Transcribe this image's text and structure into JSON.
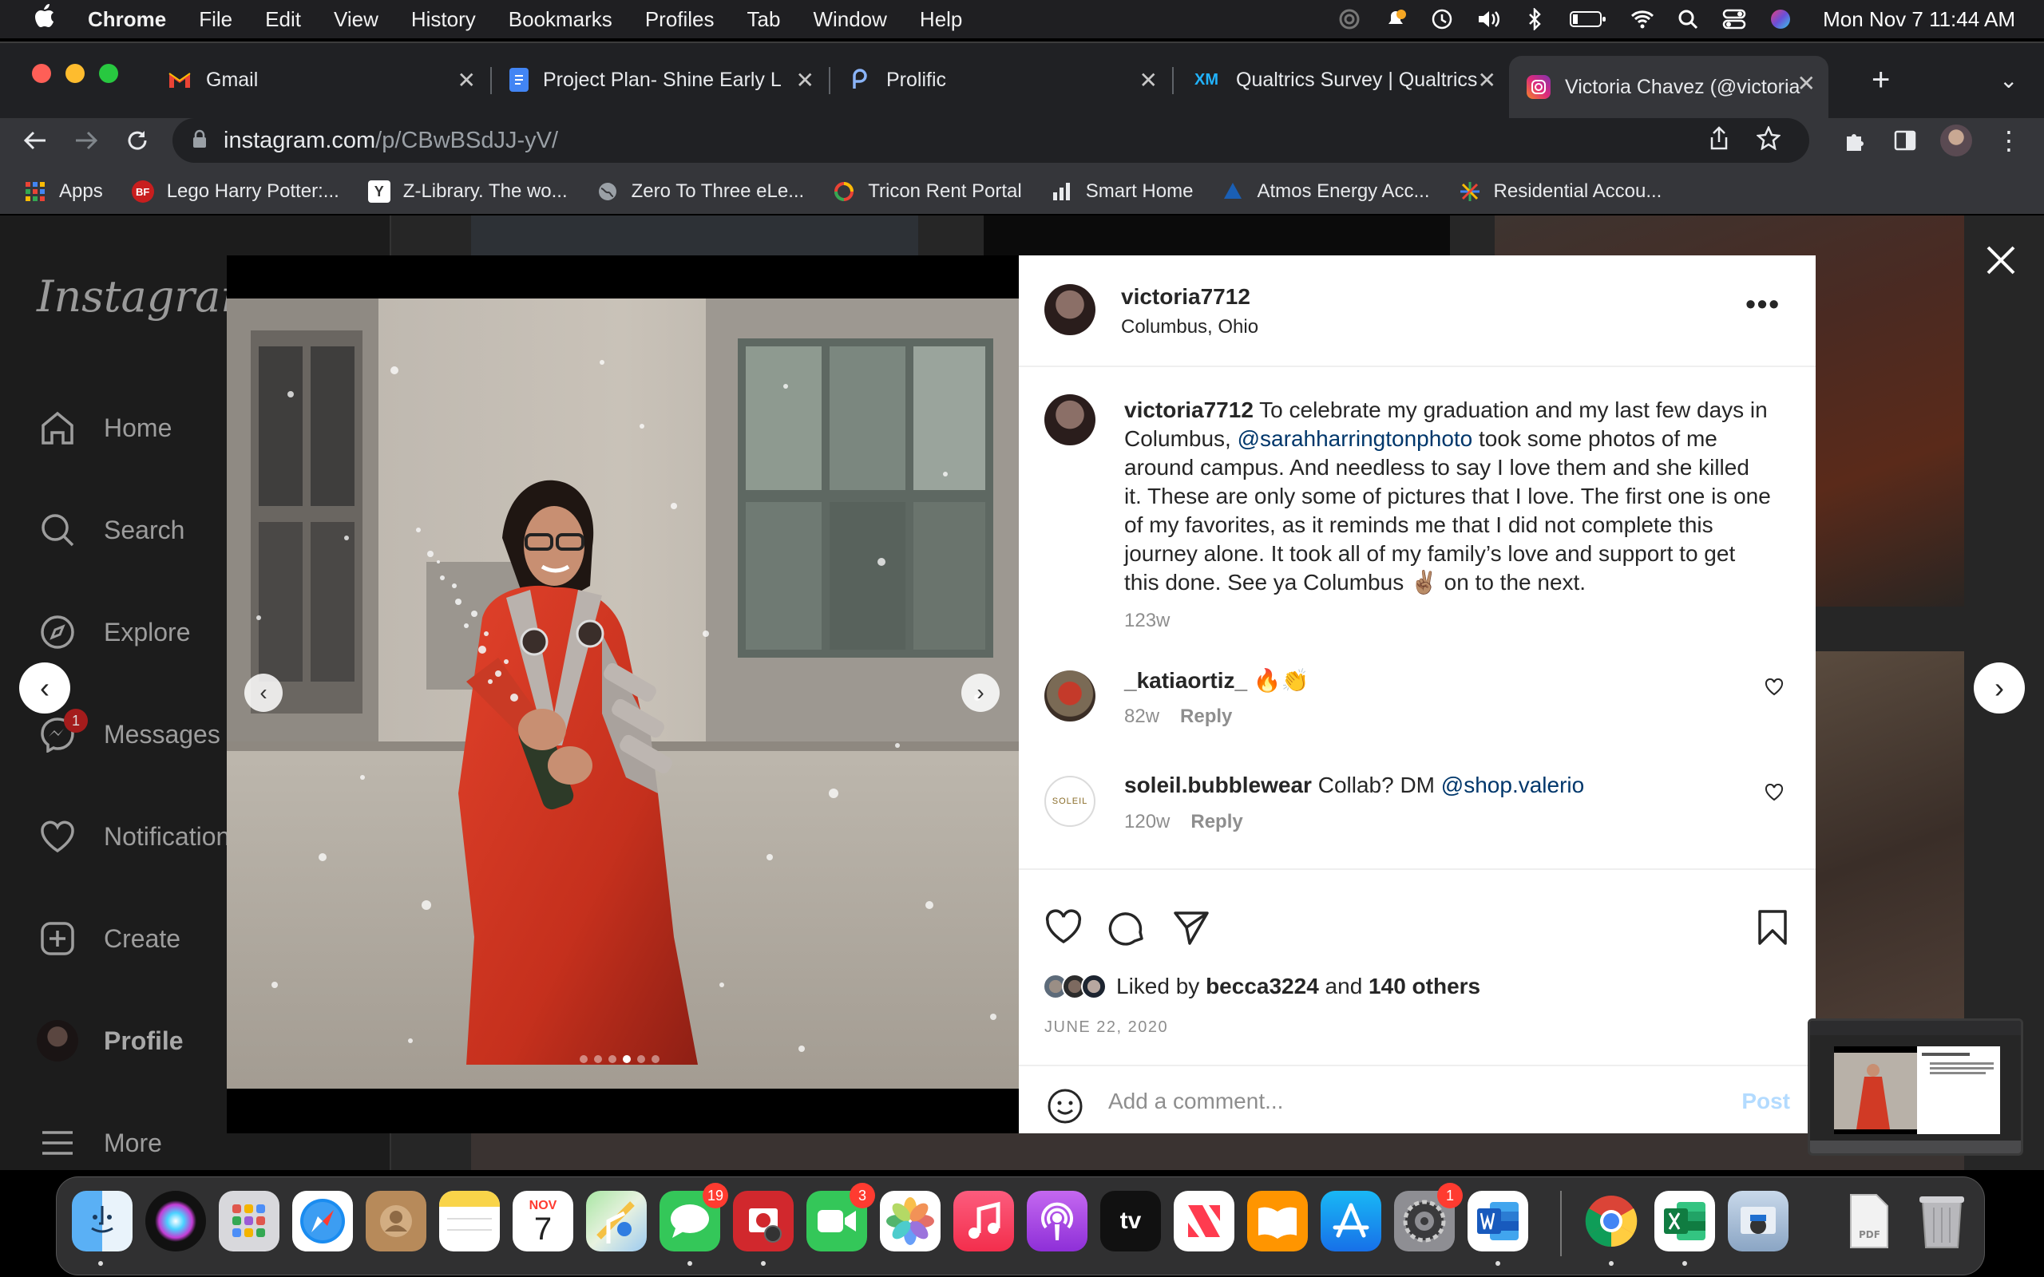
{
  "menubar": {
    "app": "Chrome",
    "items": [
      "File",
      "Edit",
      "View",
      "History",
      "Bookmarks",
      "Profiles",
      "Tab",
      "Window",
      "Help"
    ],
    "clock": "Mon Nov 7  11:44 AM"
  },
  "tabs": [
    {
      "label": "Gmail",
      "icon": "gmail-icon"
    },
    {
      "label": "Project Plan- Shine Early L",
      "icon": "docs-icon"
    },
    {
      "label": "Prolific",
      "icon": "prolific-icon"
    },
    {
      "label": "Qualtrics Survey | Qualtrics",
      "icon": "qualtrics-icon"
    },
    {
      "label": "Victoria Chavez (@victoria",
      "icon": "instagram-icon"
    }
  ],
  "omnibox": {
    "host": "instagram.com",
    "path": "/p/CBwBSdJJ-yV/"
  },
  "bookmarks": [
    {
      "label": "Apps",
      "icon": "apps-grid-icon"
    },
    {
      "label": "Lego Harry Potter:...",
      "icon": "bf-icon"
    },
    {
      "label": "Z-Library. The wo...",
      "icon": "zlib-icon"
    },
    {
      "label": "Zero To Three eLe...",
      "icon": "globe-icon"
    },
    {
      "label": "Tricon Rent Portal",
      "icon": "tricon-icon"
    },
    {
      "label": "Smart Home",
      "icon": "bars-icon"
    },
    {
      "label": "Atmos Energy Acc...",
      "icon": "atmos-icon"
    },
    {
      "label": "Residential Accou...",
      "icon": "burst-icon"
    }
  ],
  "sidebar": {
    "logo": "Instagram",
    "items": [
      {
        "label": "Home",
        "icon": "home-icon"
      },
      {
        "label": "Search",
        "icon": "search-icon"
      },
      {
        "label": "Explore",
        "icon": "compass-icon"
      },
      {
        "label": "Messages",
        "icon": "messenger-icon",
        "badge": "1"
      },
      {
        "label": "Notifications",
        "icon": "heart-icon"
      },
      {
        "label": "Create",
        "icon": "plus-square-icon"
      },
      {
        "label": "Profile",
        "icon": "avatar"
      },
      {
        "label": "More",
        "icon": "menu-icon"
      }
    ]
  },
  "post": {
    "username": "victoria7712",
    "location": "Columbus, Ohio",
    "caption_user": "victoria7712",
    "caption_pre": " To celebrate my graduation and my last few days in Columbus, ",
    "caption_mention": "@sarahharringtonphoto",
    "caption_post": " took some photos of me around campus. And needless to say I love them and she killed it. These are only some of pictures that I love. The first one is one of my favorites, as it reminds me that I did not complete this journey alone. It took all of my family’s love and support to get this done. See ya Columbus ✌🏽 on to the next.",
    "caption_age": "123w",
    "comments": [
      {
        "user": "_katiaortiz_",
        "text": " 🔥👏",
        "age": "82w",
        "reply": "Reply"
      },
      {
        "user": "soleil.bubblewear",
        "text": " Collab? DM ",
        "mention": "@shop.valerio",
        "age": "120w",
        "reply": "Reply",
        "avatar_text": "SOLEIL"
      }
    ],
    "liked_by_prefix": "Liked by ",
    "liked_by_user": "becca3224",
    "liked_by_mid": " and ",
    "liked_by_others": "140 others",
    "date": "JUNE 22, 2020",
    "comment_placeholder": "Add a comment...",
    "post_button": "Post",
    "carousel": {
      "count": 6,
      "active": 3
    }
  },
  "dock": {
    "calendar_month": "NOV",
    "calendar_day": "7",
    "badges": {
      "messages": "19",
      "facetime": "3",
      "settings": "1"
    },
    "tv_label": "tv"
  }
}
